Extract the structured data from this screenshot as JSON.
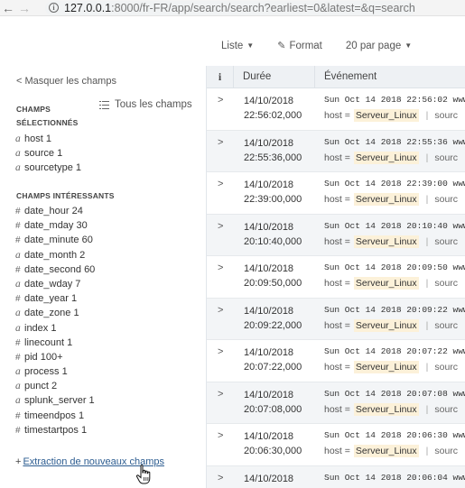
{
  "browser": {
    "url_host": "127.0.0.1",
    "url_rest": ":8000/fr-FR/app/search/search?earliest=0&latest=&q=search",
    "back_glyph": "←",
    "forward_glyph": "→"
  },
  "toolbar": {
    "list_label": "Liste",
    "format_label": "Format",
    "per_page_label": "20 par page"
  },
  "sidebar": {
    "hide_fields": "< Masquer les champs",
    "all_fields": "Tous les champs",
    "selected_title_1": "CHAMPS",
    "selected_title_2": "SÉLECTIONNÉS",
    "selected_fields": [
      {
        "type": "a",
        "name": "host",
        "count": "1"
      },
      {
        "type": "a",
        "name": "source",
        "count": "1"
      },
      {
        "type": "a",
        "name": "sourcetype",
        "count": "1"
      }
    ],
    "interesting_title": "CHAMPS INTÉRESSANTS",
    "interesting_fields": [
      {
        "type": "#",
        "name": "date_hour",
        "count": "24"
      },
      {
        "type": "#",
        "name": "date_mday",
        "count": "30"
      },
      {
        "type": "#",
        "name": "date_minute",
        "count": "60"
      },
      {
        "type": "a",
        "name": "date_month",
        "count": "2"
      },
      {
        "type": "#",
        "name": "date_second",
        "count": "60"
      },
      {
        "type": "a",
        "name": "date_wday",
        "count": "7"
      },
      {
        "type": "#",
        "name": "date_year",
        "count": "1"
      },
      {
        "type": "a",
        "name": "date_zone",
        "count": "1"
      },
      {
        "type": "a",
        "name": "index",
        "count": "1"
      },
      {
        "type": "#",
        "name": "linecount",
        "count": "1"
      },
      {
        "type": "#",
        "name": "pid",
        "count": "100+"
      },
      {
        "type": "a",
        "name": "process",
        "count": "1"
      },
      {
        "type": "a",
        "name": "punct",
        "count": "2"
      },
      {
        "type": "a",
        "name": "splunk_server",
        "count": "1"
      },
      {
        "type": "#",
        "name": "timeendpos",
        "count": "1"
      },
      {
        "type": "#",
        "name": "timestartpos",
        "count": "1"
      }
    ],
    "extract_plus": "+",
    "extract_label": "Extraction de nouveaux champs"
  },
  "table": {
    "col_info": "i",
    "col_duration": "Durée",
    "col_event": "Événement",
    "host_key": "host =",
    "source_key": "sourc",
    "rows": [
      {
        "date": "14/10/2018",
        "time": "22:56:02,000",
        "event": "Sun Oct 14 2018 22:56:02 www",
        "host": "Serveur_Linux"
      },
      {
        "date": "14/10/2018",
        "time": "22:55:36,000",
        "event": "Sun Oct 14 2018 22:55:36 www",
        "host": "Serveur_Linux"
      },
      {
        "date": "14/10/2018",
        "time": "22:39:00,000",
        "event": "Sun Oct 14 2018 22:39:00 www",
        "host": "Serveur_Linux"
      },
      {
        "date": "14/10/2018",
        "time": "20:10:40,000",
        "event": "Sun Oct 14 2018 20:10:40 www",
        "host": "Serveur_Linux"
      },
      {
        "date": "14/10/2018",
        "time": "20:09:50,000",
        "event": "Sun Oct 14 2018 20:09:50 www",
        "host": "Serveur_Linux"
      },
      {
        "date": "14/10/2018",
        "time": "20:09:22,000",
        "event": "Sun Oct 14 2018 20:09:22 www",
        "host": "Serveur_Linux"
      },
      {
        "date": "14/10/2018",
        "time": "20:07:22,000",
        "event": "Sun Oct 14 2018 20:07:22 www",
        "host": "Serveur_Linux"
      },
      {
        "date": "14/10/2018",
        "time": "20:07:08,000",
        "event": "Sun Oct 14 2018 20:07:08 www",
        "host": "Serveur_Linux"
      },
      {
        "date": "14/10/2018",
        "time": "20:06:30,000",
        "event": "Sun Oct 14 2018 20:06:30 www",
        "host": "Serveur_Linux"
      },
      {
        "date": "14/10/2018",
        "time": "",
        "event": "Sun Oct 14 2018 20:06:04 www",
        "host": ""
      }
    ]
  },
  "colors": {
    "link": "#2d5d91",
    "host_highlight": "#fcf1d9",
    "header_bg": "#eef1f4",
    "alt_row_bg": "#f3f5f7"
  }
}
